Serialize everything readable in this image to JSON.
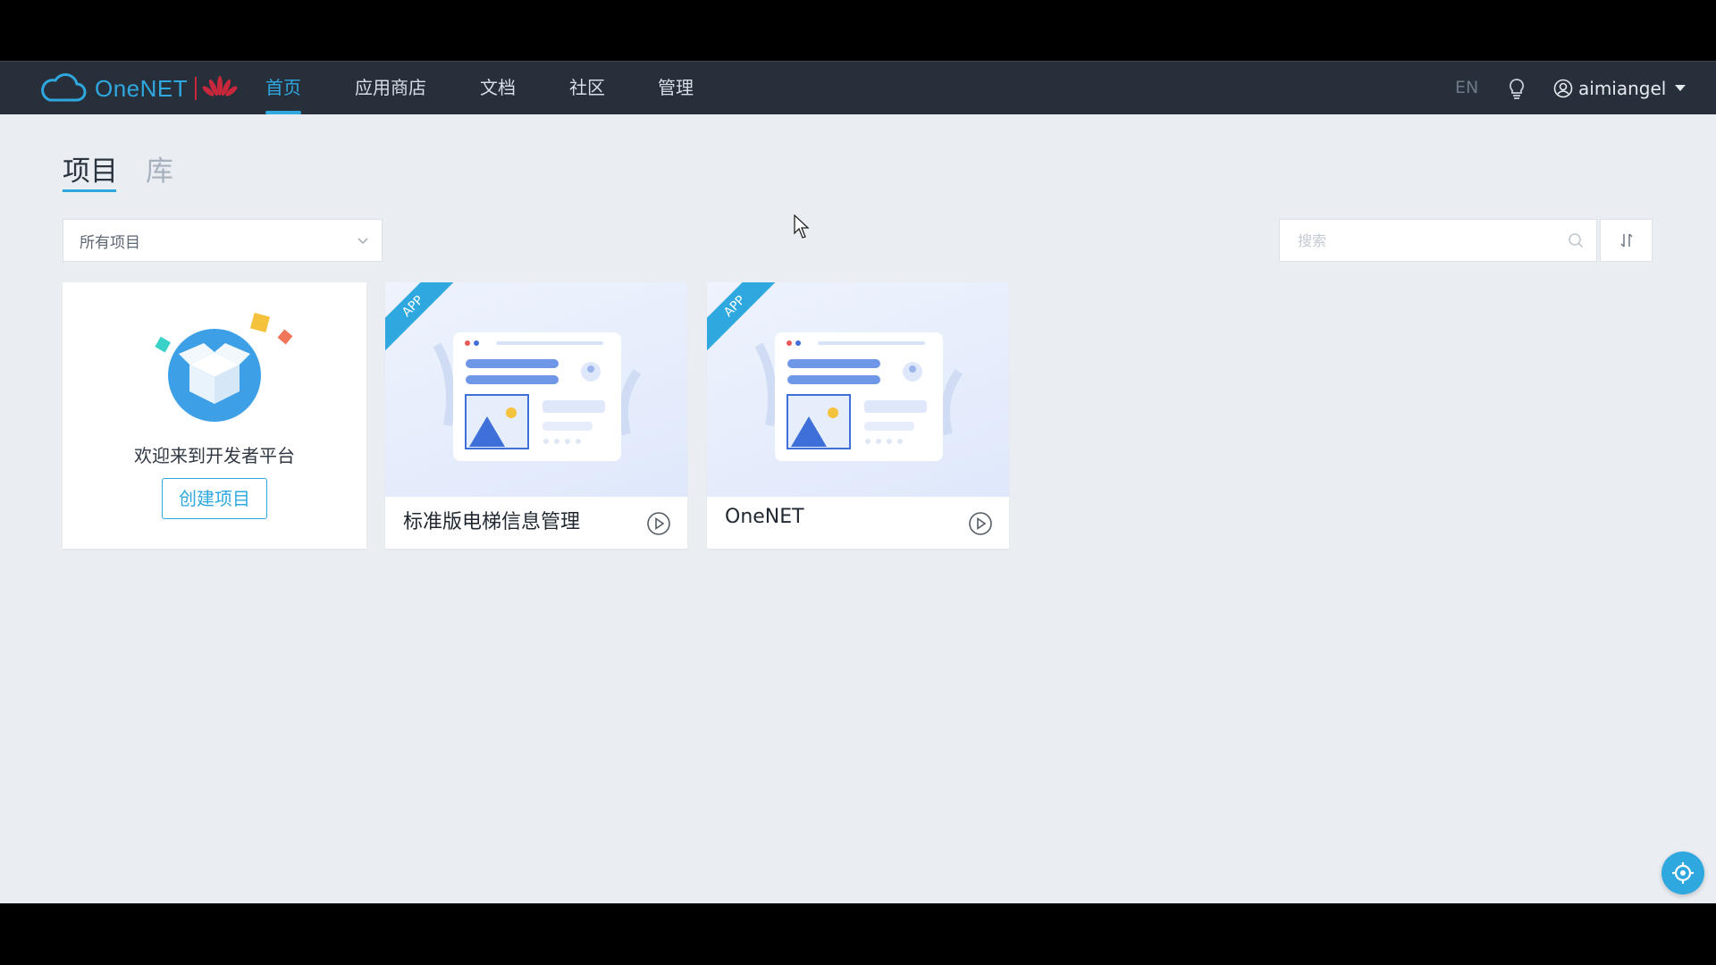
{
  "brand": {
    "name": "OneNET"
  },
  "nav": {
    "items": [
      {
        "label": "首页",
        "active": true
      },
      {
        "label": "应用商店"
      },
      {
        "label": "文档"
      },
      {
        "label": "社区"
      },
      {
        "label": "管理"
      }
    ],
    "lang": "EN",
    "username": "aimiangel"
  },
  "tabs": [
    {
      "label": "项目",
      "active": true
    },
    {
      "label": "库"
    }
  ],
  "filter": {
    "selected": "所有项目"
  },
  "search": {
    "placeholder": "搜索"
  },
  "welcome": {
    "text": "欢迎来到开发者平台",
    "create_label": "创建项目"
  },
  "projects": [
    {
      "badge": "APP",
      "name": "标准版电梯信息管理"
    },
    {
      "badge": "APP",
      "name": "OneNET"
    }
  ],
  "colors": {
    "accent": "#2fa8e0",
    "nav_bg": "#272f3a",
    "page_bg": "#eaeef2"
  }
}
